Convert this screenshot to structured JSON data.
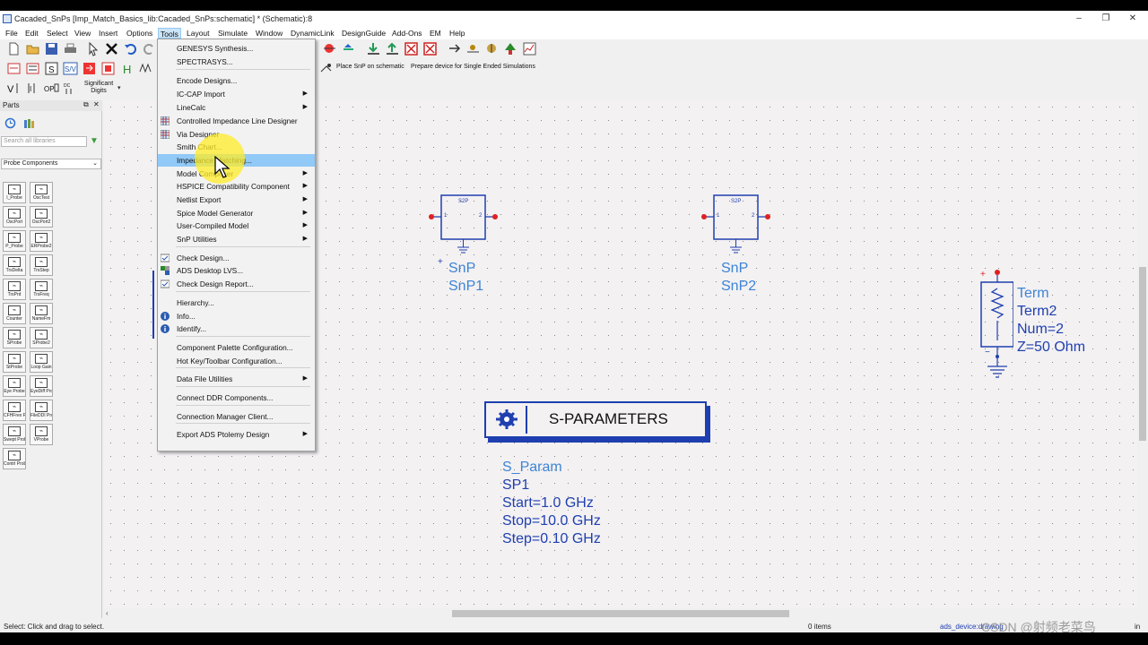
{
  "window": {
    "title": "Cacaded_SnPs [Imp_Match_Basics_lib:Cacaded_SnPs:schematic] * (Schematic):8",
    "controls": [
      "–",
      "❐",
      "✕"
    ]
  },
  "menubar": [
    "File",
    "Edit",
    "Select",
    "View",
    "Insert",
    "Options",
    "Tools",
    "Layout",
    "Simulate",
    "Window",
    "DynamicLink",
    "DesignGuide",
    "Add-Ons",
    "EM",
    "Help"
  ],
  "toolbar": {
    "place_snp_label": "Place SnP on schematic",
    "prepare_device_label": "Prepare device for Single Ended Simulations",
    "significant_digits_label": "Significant Digits"
  },
  "parts_panel": {
    "title": "Parts",
    "search_placeholder": "Search all libraries",
    "library": "Probe Components",
    "items": [
      "I_Probe",
      "OscTest",
      "OscPort",
      "OscPort2",
      "P_Probe",
      "ERProbe2",
      "TrsDelta",
      "TrsStep",
      "TrsPrd",
      "TrsFreq",
      "Counter",
      "NameFm",
      "SProbe",
      "SProbe2",
      "StProbe",
      "Loop Gain",
      "Eye Probe",
      "EyeDiff Probe",
      "CFHFrex Probe",
      "FileDDI Probe",
      "Swept Probe",
      "VProbe",
      "Contrl Probe"
    ]
  },
  "tools_menu": {
    "items": [
      {
        "label": "GENESYS Synthesis...",
        "submenu": false,
        "icon": ""
      },
      {
        "label": "SPECTRASYS...",
        "submenu": false,
        "icon": ""
      },
      {
        "label": "Encode Designs...",
        "submenu": false,
        "icon": ""
      },
      {
        "label": "IC-CAP Import",
        "submenu": true,
        "icon": ""
      },
      {
        "label": "LineCalc",
        "submenu": true,
        "icon": ""
      },
      {
        "label": "Controlled Impedance Line Designer",
        "submenu": false,
        "icon": "grid"
      },
      {
        "label": "Via Designer",
        "submenu": false,
        "icon": "grid"
      },
      {
        "label": "Smith Chart...",
        "submenu": false,
        "icon": ""
      },
      {
        "label": "Impedance Matching...",
        "submenu": false,
        "icon": "",
        "highlighted": true
      },
      {
        "label": "Model Composer",
        "submenu": true,
        "icon": ""
      },
      {
        "label": "HSPICE Compatibility Component",
        "submenu": true,
        "icon": ""
      },
      {
        "label": "Netlist Export",
        "submenu": true,
        "icon": ""
      },
      {
        "label": "Spice Model Generator",
        "submenu": true,
        "icon": ""
      },
      {
        "label": "User-Compiled Model",
        "submenu": true,
        "icon": ""
      },
      {
        "label": "SnP Utilities",
        "submenu": true,
        "icon": ""
      },
      {
        "label": "Check Design...",
        "submenu": false,
        "icon": "check"
      },
      {
        "label": "ADS Desktop LVS...",
        "submenu": false,
        "icon": "lvs"
      },
      {
        "label": "Check Design Report...",
        "submenu": false,
        "icon": "check"
      },
      {
        "label": "Hierarchy...",
        "submenu": false,
        "icon": ""
      },
      {
        "label": "Info...",
        "submenu": false,
        "icon": "info"
      },
      {
        "label": "Identify...",
        "submenu": false,
        "icon": "info"
      },
      {
        "label": "Component Palette Configuration...",
        "submenu": false,
        "icon": ""
      },
      {
        "label": "Hot Key/Toolbar Configuration...",
        "submenu": false,
        "icon": ""
      },
      {
        "label": "Data File Utilities",
        "submenu": true,
        "icon": ""
      },
      {
        "label": "Connect DDR Components...",
        "submenu": false,
        "icon": ""
      },
      {
        "label": "Connection Manager Client...",
        "submenu": false,
        "icon": ""
      },
      {
        "label": "Export ADS Ptolemy Design",
        "submenu": true,
        "icon": ""
      }
    ]
  },
  "schematic": {
    "snp1": {
      "symbol": "S2P",
      "type": "SnP",
      "name": "SnP1",
      "port1": "1",
      "port2": "2"
    },
    "snp2": {
      "symbol": "S2P",
      "type": "SnP",
      "name": "SnP2",
      "port1": "1",
      "port2": "2"
    },
    "term": {
      "type": "Term",
      "name": "Term2",
      "num": "Num=2",
      "z": "Z=50 Ohm"
    },
    "sparam": {
      "banner": "S-PARAMETERS",
      "type": "S_Param",
      "name": "SP1",
      "start": "Start=1.0 GHz",
      "stop": "Stop=10.0 GHz",
      "step": "Step=0.10 GHz"
    }
  },
  "statusbar": {
    "hint": "Select: Click and drag to select.",
    "items": "0 items",
    "context": "ads_device:drawing",
    "units": "in"
  },
  "watermark": "CSDN @射频老菜鸟",
  "colors": {
    "schematic_blue": "#1f3fb0",
    "label_blue": "#3d84d6",
    "menu_highlight": "#91c9f7",
    "pin_red": "#e02020"
  }
}
